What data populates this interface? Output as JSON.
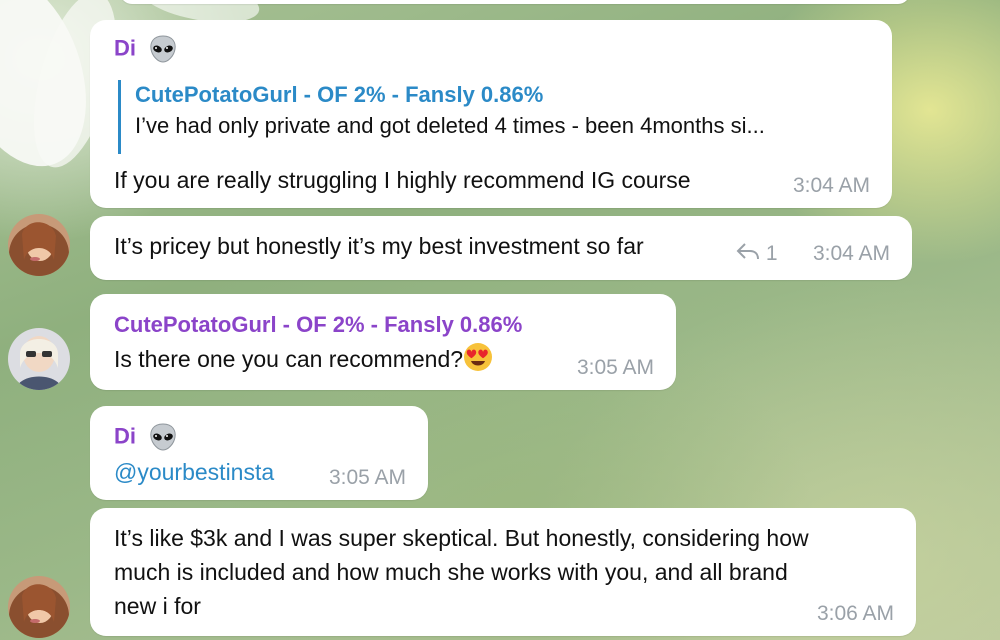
{
  "messages": [
    {
      "sender": "Di",
      "sender_emoji": "alien-emoji",
      "reply": {
        "name": "CutePotatoGurl - OF 2% - Fansly 0.86%",
        "text": "I’ve had only private and got deleted 4 times - been 4months si..."
      },
      "text": "If you are really struggling I highly recommend IG course",
      "time": "3:04 AM"
    },
    {
      "text": "It’s pricey but honestly it’s my best investment so far",
      "replies_count": "1",
      "time": "3:04 AM"
    },
    {
      "sender": "CutePotatoGurl - OF 2% - Fansly 0.86%",
      "text": "Is there one you can recommend?",
      "emoji": "heart-eyes-emoji",
      "time": "3:05 AM"
    },
    {
      "sender": "Di",
      "sender_emoji": "alien-emoji",
      "link": "@yourbestinsta",
      "time": "3:05 AM"
    },
    {
      "text_lines": [
        "It’s like $3k and I was super skeptical. But honestly, considering how",
        "much is included and how much she works with you, and all brand",
        "new i for"
      ],
      "time": "3:06 AM"
    }
  ],
  "colors": {
    "sender_purple": "#8b44c9",
    "link_blue": "#2b8ac7",
    "time_gray": "#9aa1a8"
  }
}
